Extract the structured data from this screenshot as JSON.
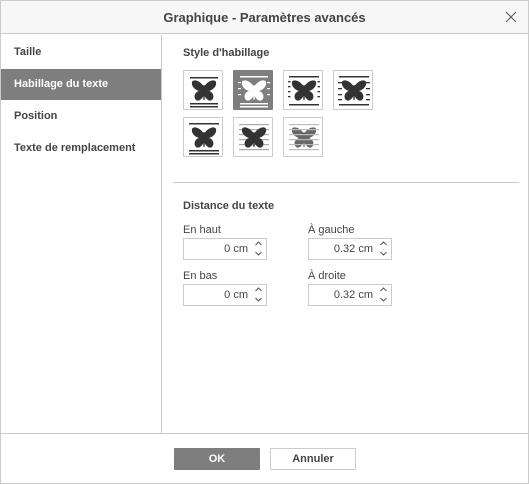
{
  "window": {
    "title": "Graphique - Paramètres avancés"
  },
  "sidebar": {
    "items": [
      {
        "label": "Taille",
        "active": false
      },
      {
        "label": "Habillage du texte",
        "active": true
      },
      {
        "label": "Position",
        "active": false
      },
      {
        "label": "Texte de remplacement",
        "active": false
      }
    ]
  },
  "wrap": {
    "heading": "Style d'habillage",
    "styles": [
      {
        "icon": "wrap-inline-icon",
        "selected": false
      },
      {
        "icon": "wrap-square-icon",
        "selected": true
      },
      {
        "icon": "wrap-tight-icon",
        "selected": false
      },
      {
        "icon": "wrap-through-icon",
        "selected": false
      },
      {
        "icon": "wrap-top-bottom-icon",
        "selected": false
      },
      {
        "icon": "wrap-in-front-icon",
        "selected": false
      },
      {
        "icon": "wrap-behind-icon",
        "selected": false
      }
    ]
  },
  "distance": {
    "heading": "Distance du texte",
    "top": {
      "label": "En haut",
      "value": "0 cm"
    },
    "left": {
      "label": "À gauche",
      "value": "0.32 cm"
    },
    "bottom": {
      "label": "En bas",
      "value": "0 cm"
    },
    "right": {
      "label": "À droite",
      "value": "0.32 cm"
    }
  },
  "footer": {
    "ok_label": "OK",
    "cancel_label": "Annuler"
  },
  "colors": {
    "accent": "#7e7e7e",
    "border": "#cbcbcb",
    "text": "#444444"
  }
}
